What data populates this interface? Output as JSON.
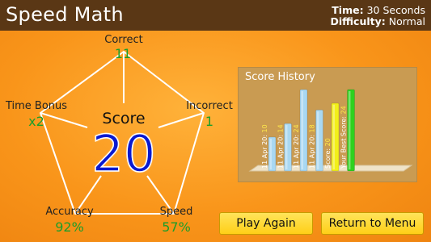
{
  "header": {
    "title": "Speed Math",
    "time_label": "Time:",
    "time_value": "30 Seconds",
    "difficulty_label": "Difficulty:",
    "difficulty_value": "Normal"
  },
  "stats": {
    "correct": {
      "label": "Correct",
      "value": "11"
    },
    "incorrect": {
      "label": "Incorrect",
      "value": "1"
    },
    "speed": {
      "label": "Speed",
      "value": "57%"
    },
    "accuracy": {
      "label": "Accuracy",
      "value": "92%"
    },
    "time_bonus": {
      "label": "Time Bonus",
      "value": "x2"
    }
  },
  "score": {
    "label": "Score",
    "value": "20"
  },
  "history": {
    "title": "Score History"
  },
  "buttons": {
    "play_again": "Play Again",
    "return_menu": "Return to Menu"
  },
  "colors": {
    "header_bg": "#5a3715",
    "value_green": "#1c9e2a",
    "score_blue": "#0a1ad0",
    "bar_blue": "#a9d8f2",
    "bar_yellow": "#f2ef1a",
    "bar_green": "#2fd11f",
    "button_yellow": "#ffd428"
  },
  "chart_data": {
    "type": "bar",
    "title": "Score History",
    "categories": [
      "11 Apr 20: 10",
      "11 Apr 20: 14",
      "11 Apr 20: 24",
      "11 Apr 20: 18",
      "Score: 20",
      "Your Best Score: 24"
    ],
    "values": [
      10,
      14,
      24,
      18,
      20,
      24
    ],
    "colors": [
      "#a9d8f2",
      "#a9d8f2",
      "#a9d8f2",
      "#a9d8f2",
      "#f2ef1a",
      "#2fd11f"
    ],
    "ylim": [
      0,
      24
    ],
    "grid": false
  }
}
